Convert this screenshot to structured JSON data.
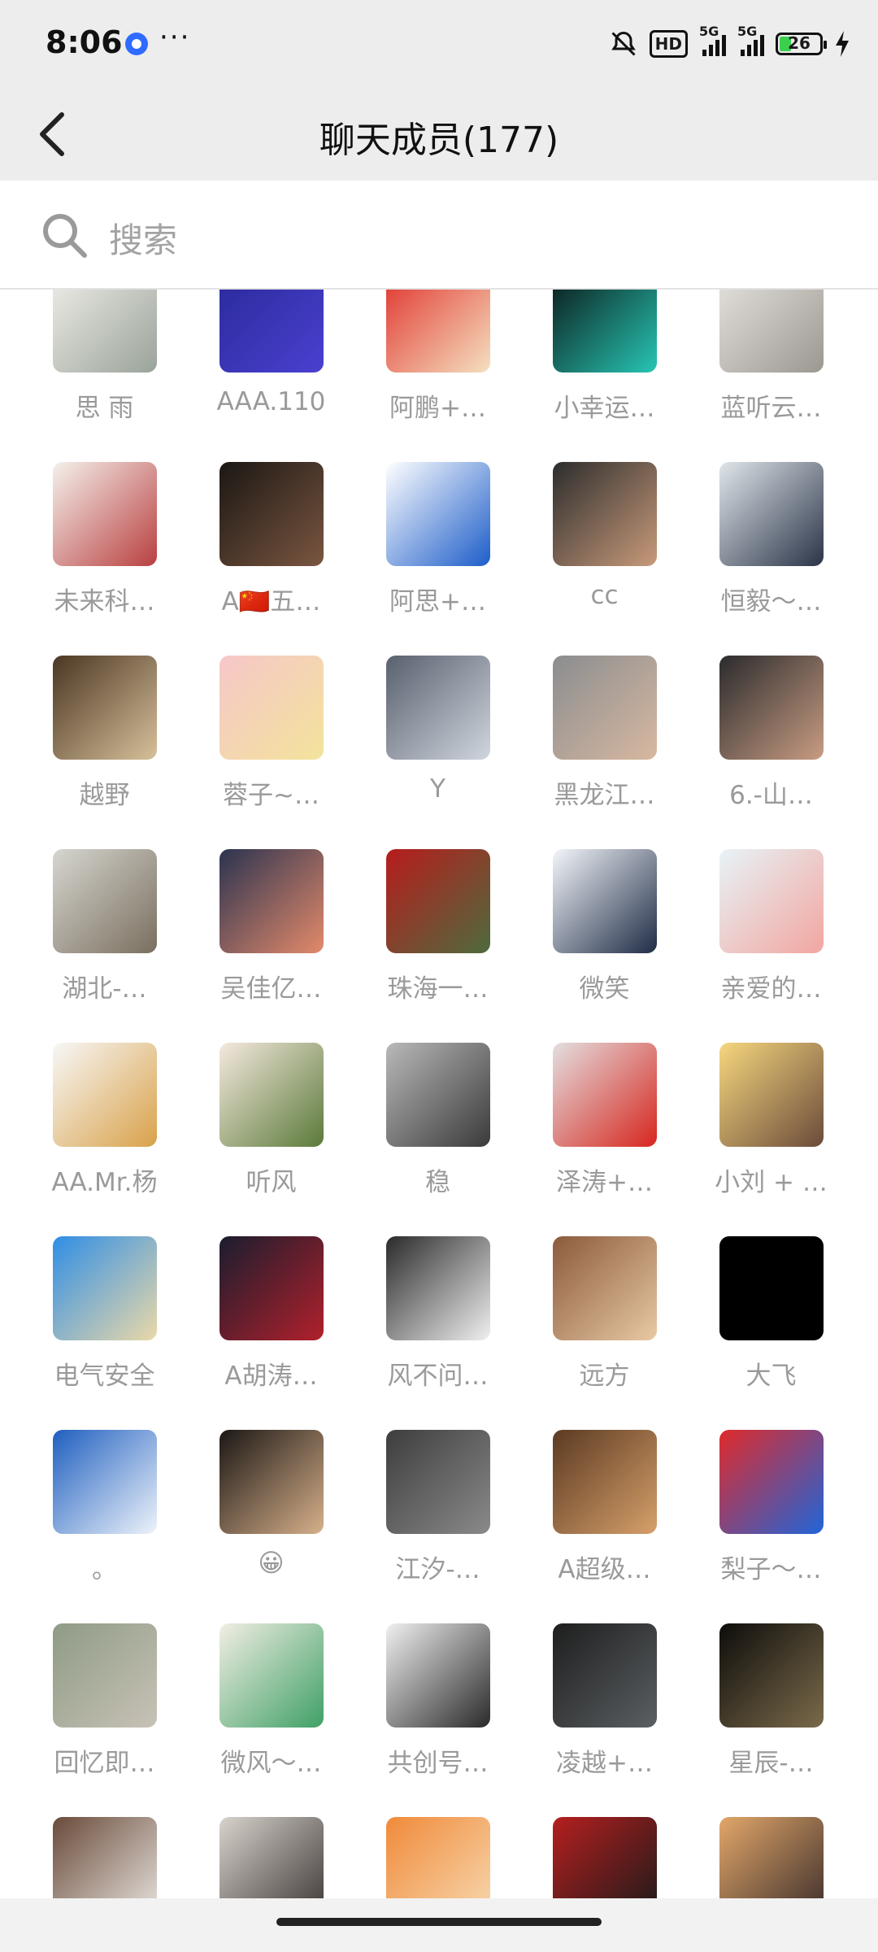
{
  "status": {
    "time": "8:06",
    "hd": "HD",
    "sig1": "5G",
    "sig2": "5G",
    "battery": "26"
  },
  "header": {
    "title": "聊天成员(177)"
  },
  "search": {
    "placeholder": "搜索"
  },
  "members": [
    {
      "name": "思  雨",
      "c1": "#f0efe9",
      "c2": "#9aa39a"
    },
    {
      "name": "AAA.110",
      "c1": "#2a2a9a",
      "c2": "#4a40d0"
    },
    {
      "name": "阿鹏+…",
      "c1": "#e0322c",
      "c2": "#f5e0c0"
    },
    {
      "name": "小幸运…",
      "c1": "#0b1616",
      "c2": "#27c6b4"
    },
    {
      "name": "蓝听云…",
      "c1": "#e7e4df",
      "c2": "#9c9791"
    },
    {
      "name": "未来科…",
      "c1": "#f4f1ec",
      "c2": "#b94040"
    },
    {
      "name": "A🇨🇳五…",
      "c1": "#1b1714",
      "c2": "#7a5640"
    },
    {
      "name": "阿思+…",
      "c1": "#ffffff",
      "c2": "#1d5dc9"
    },
    {
      "name": "cc",
      "c1": "#2d2d2d",
      "c2": "#c89a7a"
    },
    {
      "name": "恒毅～…",
      "c1": "#dfe6ea",
      "c2": "#2b3448"
    },
    {
      "name": "越野",
      "c1": "#4a3623",
      "c2": "#d7c09a"
    },
    {
      "name": "蓉子~…",
      "c1": "#f6c7c9",
      "c2": "#f3e39b"
    },
    {
      "name": "Y",
      "c1": "#59606e",
      "c2": "#cfd6de"
    },
    {
      "name": "黑龙江…",
      "c1": "#8a8d90",
      "c2": "#d8b8a0"
    },
    {
      "name": "6.-山…",
      "c1": "#2b2b2d",
      "c2": "#c89c82"
    },
    {
      "name": "湖北-…",
      "c1": "#d6d6d0",
      "c2": "#7a6f5f"
    },
    {
      "name": "吴佳亿…",
      "c1": "#2b3350",
      "c2": "#e38a6a"
    },
    {
      "name": "珠海一…",
      "c1": "#b71c1c",
      "c2": "#4e6b3d"
    },
    {
      "name": "微笑",
      "c1": "#f3f6fa",
      "c2": "#1f2c46"
    },
    {
      "name": "亲爱的…",
      "c1": "#e7f3f7",
      "c2": "#f2a6a0"
    },
    {
      "name": "AA.Mr.杨",
      "c1": "#f7f7f7",
      "c2": "#d9a24a"
    },
    {
      "name": "听风",
      "c1": "#f5e9de",
      "c2": "#5b7a3a"
    },
    {
      "name": "稳",
      "c1": "#b9b9b9",
      "c2": "#3a3a3a"
    },
    {
      "name": "泽涛+…",
      "c1": "#e3dfe0",
      "c2": "#d7261e"
    },
    {
      "name": "小刘 + …",
      "c1": "#f6d77e",
      "c2": "#6b4b3a"
    },
    {
      "name": "电气安全",
      "c1": "#2f8ee6",
      "c2": "#ead9a8"
    },
    {
      "name": "A胡涛…",
      "c1": "#1a1d2e",
      "c2": "#b1202c"
    },
    {
      "name": "风不问…",
      "c1": "#2a2a2a",
      "c2": "#f0f0f0"
    },
    {
      "name": "远方",
      "c1": "#8b5a3c",
      "c2": "#e8c9a4"
    },
    {
      "name": "大飞",
      "c1": "#000000",
      "c2": "#000000"
    },
    {
      "name": "。",
      "c1": "#1f5fbf",
      "c2": "#eef3fa"
    },
    {
      "name": "😀",
      "c1": "#1b1715",
      "c2": "#d7b08a"
    },
    {
      "name": "江汐-…",
      "c1": "#3d3d3d",
      "c2": "#8a8a8a"
    },
    {
      "name": "A超级…",
      "c1": "#5b3a22",
      "c2": "#d6a06a"
    },
    {
      "name": "梨子～…",
      "c1": "#e02a2a",
      "c2": "#2065d8"
    },
    {
      "name": "回忆即…",
      "c1": "#8e9b86",
      "c2": "#c8c2b6"
    },
    {
      "name": "微风～…",
      "c1": "#f2eee4",
      "c2": "#3fa066"
    },
    {
      "name": "共创号…",
      "c1": "#f0f0f0",
      "c2": "#2a2a2a"
    },
    {
      "name": "凌越+…",
      "c1": "#1e1e1e",
      "c2": "#5a5f62"
    },
    {
      "name": "星辰-…",
      "c1": "#0e0d0b",
      "c2": "#7a6a4a"
    },
    {
      "name": "",
      "c1": "#6a4a3a",
      "c2": "#e9e6e1"
    },
    {
      "name": "",
      "c1": "#d8d3cc",
      "c2": "#3a3433"
    },
    {
      "name": "",
      "c1": "#f08a3a",
      "c2": "#f7d9b0"
    },
    {
      "name": "",
      "c1": "#b51f1f",
      "c2": "#1a1a1a"
    },
    {
      "name": "",
      "c1": "#e2a76a",
      "c2": "#3a2c2a"
    }
  ]
}
